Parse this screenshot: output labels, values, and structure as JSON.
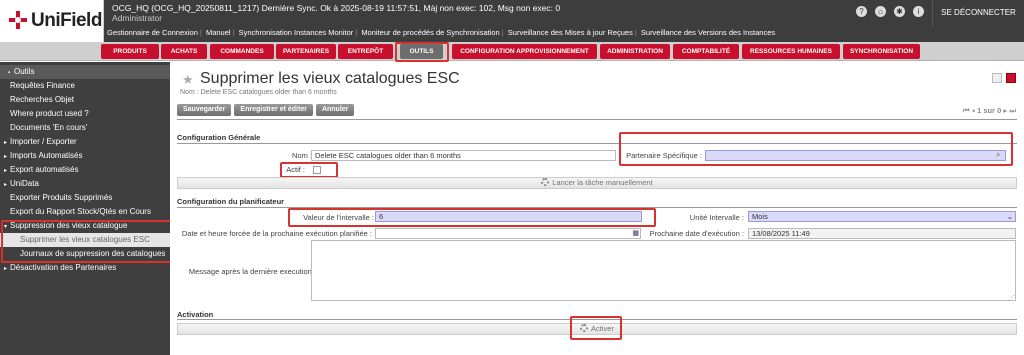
{
  "header": {
    "brand": "UniField",
    "db_line": "OCG_HQ (OCG_HQ_20250811_1217)   Dernière Sync. Ok à 2025-08-19 11:57:51, Màj non exec: 102, Msg non exec: 0",
    "user": "Administrator",
    "logout": "SE DÉCONNECTER",
    "links": [
      "Gestionnaire de Connexion",
      "Manuel",
      "Synchronisation Instances Monitor",
      "Moniteur de procédés de Synchronisation",
      "Surveillance des Mises à jour Reçues",
      "Surveillance des Versions des Instances"
    ]
  },
  "menu": [
    "PRODUITS",
    "ACHATS",
    "COMMANDES",
    "PARTENAIRES",
    "ENTREPÔT",
    "OUTILS",
    "CONFIGURATION APPROVISIONNEMENT",
    "ADMINISTRATION",
    "COMPTABILITÉ",
    "RESSOURCES HUMAINES",
    "SYNCHRONISATION"
  ],
  "sidebar": {
    "head": "Outils",
    "items": [
      "Requêtes Finance",
      "Recherches Objet",
      "Where product used ?",
      "Documents 'En cours'",
      "Importer / Exporter",
      "Imports Automatisés",
      "Export automatisés",
      "UniData",
      "Exporter Produits Supprimés",
      "Export du Rapport Stock/Qtés en Cours",
      "Suppression des vieux catalogue",
      "Supprimer les vieux catalogues ESC",
      "Journaux de suppression des catalogues",
      "Désactivation des Partenaires"
    ]
  },
  "page": {
    "title": "Supprimer les vieux catalogues ESC",
    "subtitle": "Nom : Delete ESC catalogues older than 6 months",
    "buttons": [
      "Sauvegarder",
      "Enregistrer et éditer",
      "Annuler"
    ],
    "pager": "1 sur 0"
  },
  "form": {
    "general_section": "Configuration Générale",
    "name_label": "Nom :",
    "name_value": "Delete ESC catalogues older than 6 months",
    "partner_label": "Partenaire Spécifique :",
    "actif_label": "Actif :",
    "launch_button": "Lancer la tâche manuellement",
    "scheduler_section": "Configuration du planificateur",
    "interval_label": "Valeur de l'intervalle :",
    "interval_value": "6",
    "unit_label": "Unité Intervalle :",
    "unit_value": "Mois",
    "forced_date_label": "Date et heure forcée de la prochaine exécution planifiée :",
    "next_date_label": "Prochaine date d'exécution :",
    "next_date_value": "13/08/2025 11:49",
    "message_label": "Message après la dernière execution :",
    "activation_section": "Activation",
    "activate_button": "Activer"
  },
  "colors": {
    "accent": "#c8102e",
    "highlight": "#d9322e",
    "required": "#d9dafa"
  }
}
